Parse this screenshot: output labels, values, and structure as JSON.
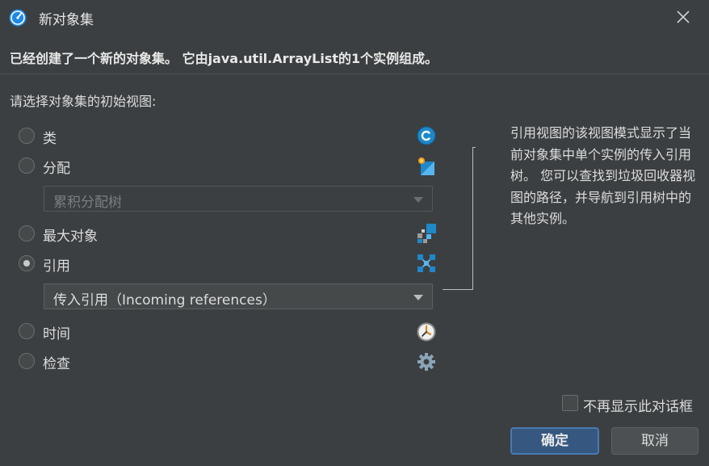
{
  "window": {
    "title": "新对象集"
  },
  "message": "已经创建了一个新的对象集。 它由java.util.ArrayList的1个实例组成。",
  "prompt": "请选择对象集的初始视图:",
  "options": [
    {
      "label": "类",
      "checked": false,
      "icon": "class-c-icon"
    },
    {
      "label": "分配",
      "checked": false,
      "icon": "allocation-icon"
    },
    {
      "label": "最大对象",
      "checked": false,
      "icon": "biggest-objects-icon"
    },
    {
      "label": "引用",
      "checked": true,
      "icon": "references-icon"
    },
    {
      "label": "时间",
      "checked": false,
      "icon": "time-clock-icon"
    },
    {
      "label": "检查",
      "checked": false,
      "icon": "inspection-gear-icon"
    }
  ],
  "allocation_combo": {
    "value": "累积分配树",
    "enabled": false
  },
  "references_combo": {
    "value": "传入引用（Incoming references）",
    "enabled": true
  },
  "description": "引用视图的该视图模式显示了当前对象集中单个实例的传入引用树。 您可以查找到垃圾回收器视图的路径，并导航到引用树中的其他实例。",
  "dont_show_again": {
    "label": "不再显示此对话框",
    "checked": false
  },
  "buttons": {
    "ok": "确定",
    "cancel": "取消"
  },
  "colors": {
    "background": "#3c3f41",
    "primary_button": "#365880",
    "accent_blue": "#1e88c8"
  }
}
